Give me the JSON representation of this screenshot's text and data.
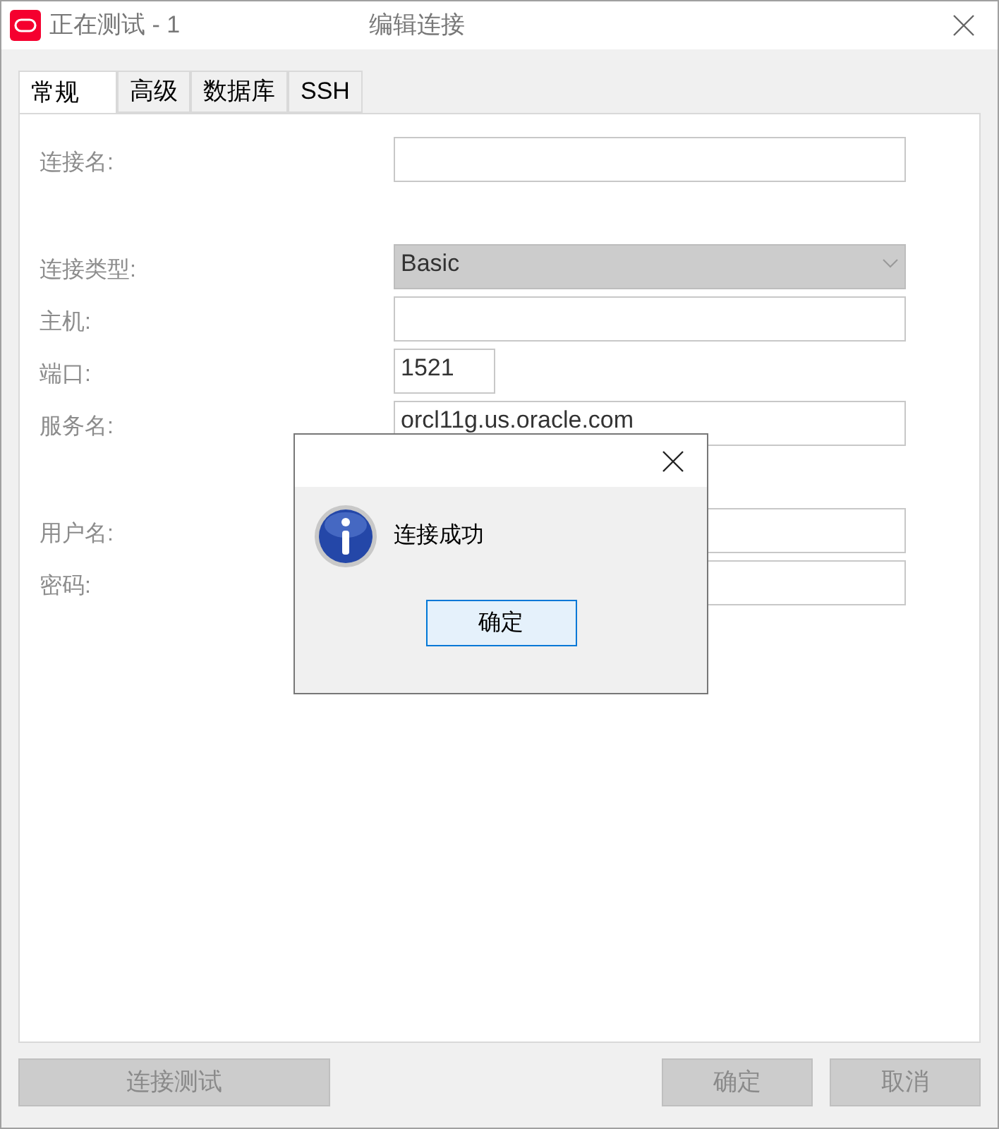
{
  "window": {
    "title_prefix": "正在测试 - 1",
    "title_suffix": "编辑连接"
  },
  "tabs": [
    {
      "label": "常规",
      "selected": true
    },
    {
      "label": "高级",
      "selected": false
    },
    {
      "label": "数据库",
      "selected": false
    },
    {
      "label": "SSH",
      "selected": false
    }
  ],
  "sections": [
    {
      "fields": [
        {
          "label": "连接名:",
          "kind": "text"
        }
      ]
    },
    {
      "fields": [
        {
          "label": "连接类型:",
          "kind": "select",
          "value": "Basic"
        },
        {
          "label": "主机:",
          "kind": "text"
        },
        {
          "label": "端口:",
          "kind": "number",
          "value": "1521"
        },
        {
          "label": "服务名:",
          "kind": "text",
          "value": "orcl11g.us.oracle.com"
        }
      ]
    },
    {
      "fields": [
        {
          "label": "用户名:",
          "kind": "text"
        },
        {
          "label": "密码:",
          "kind": "text"
        }
      ]
    }
  ],
  "buttons": [
    {
      "label": "连接测试",
      "disabled": true
    },
    {
      "label": "确定",
      "disabled": true
    },
    {
      "label": "取消",
      "disabled": true
    }
  ],
  "message_box": {
    "message": "连接成功",
    "button": "确定"
  }
}
